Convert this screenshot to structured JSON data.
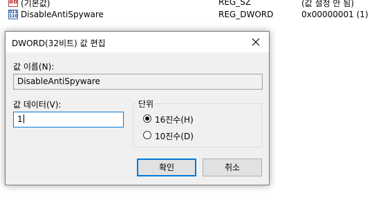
{
  "background_list": {
    "rows": [
      {
        "icon": "string-value-icon",
        "name": "(기본값)",
        "type": "REG_SZ",
        "data": "(값 설정 안 됨)"
      },
      {
        "icon": "dword-value-icon",
        "name": "DisableAntiSpyware",
        "type": "REG_DWORD",
        "data": "0x00000001 (1)"
      }
    ]
  },
  "dialog": {
    "title": "DWORD(32비트) 값 편집",
    "value_name_label": "값 이름(N):",
    "value_name": "DisableAntiSpyware",
    "value_data_label": "값 데이터(V):",
    "value_data": "1",
    "base_group_label": "단위",
    "base_options": [
      {
        "label": "16진수(H)",
        "selected": true
      },
      {
        "label": "10진수(D)",
        "selected": false
      }
    ],
    "ok_label": "확인",
    "cancel_label": "취소"
  },
  "colors": {
    "accent": "#0078d7",
    "dialog_bg": "#f0f0f0"
  }
}
